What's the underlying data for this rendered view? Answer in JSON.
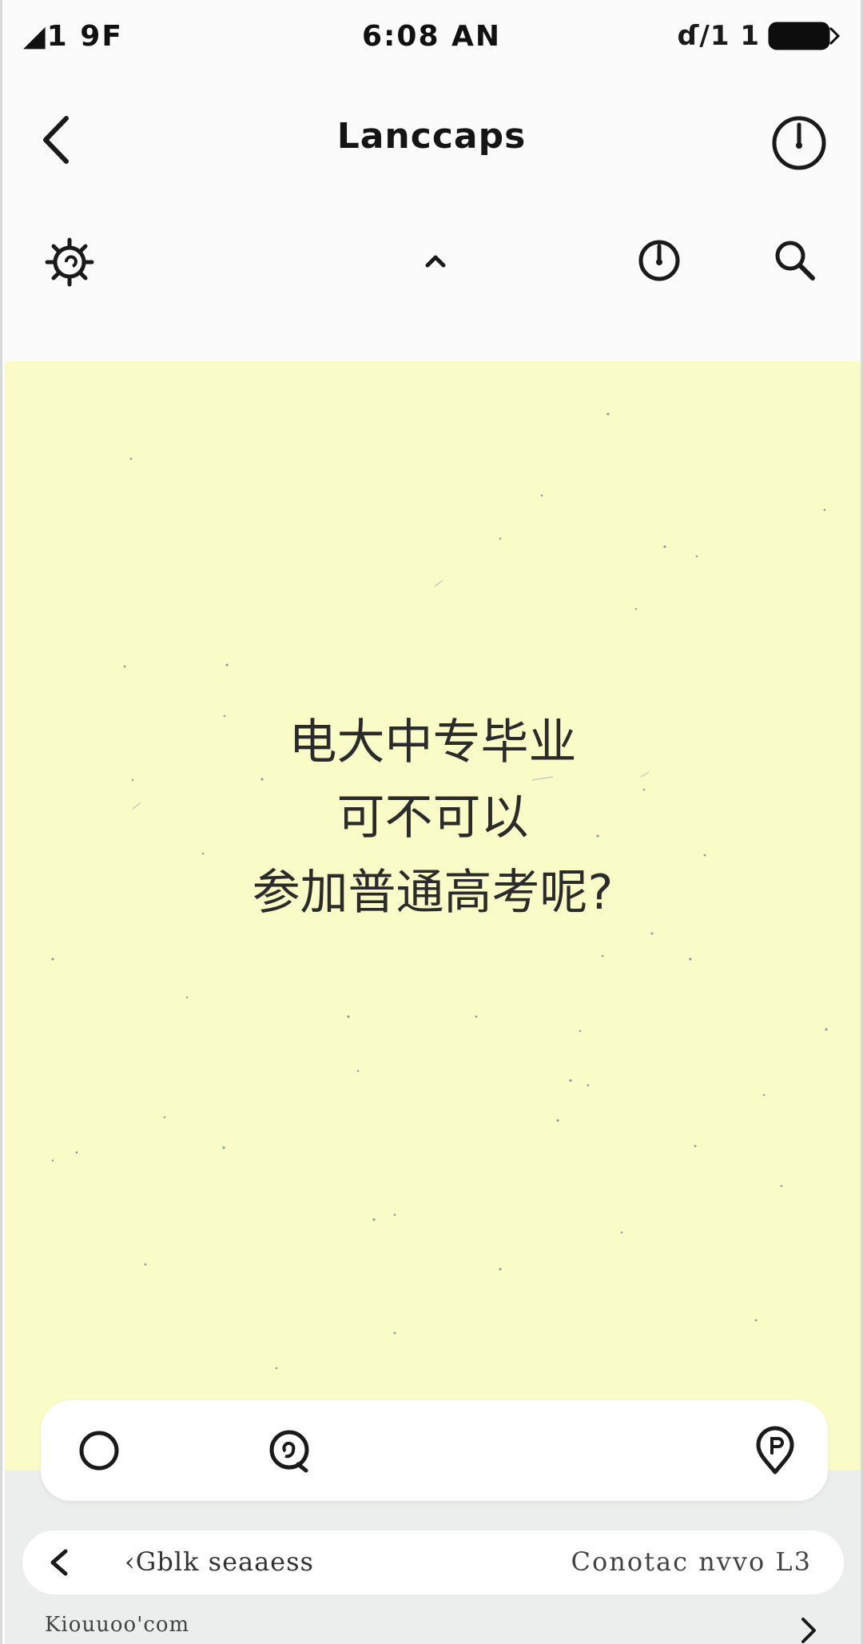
{
  "status_bar": {
    "left": "◢1 9F",
    "time": "6:08 AN",
    "signal": "ɗ/1 1"
  },
  "header": {
    "title": "Lanccaps"
  },
  "content": {
    "background_color": "#fafcc8",
    "question_lines": [
      "电大中专毕业",
      "可不可以",
      "参加普通高考呢?"
    ]
  },
  "bottom_bar": {
    "address_left": "‹Gblk seaaess",
    "address_right": "Conotac nvvo L3",
    "url": "Kiouuoo'com"
  },
  "icons": {
    "back": "chevron-left-icon",
    "history": "clock-icon",
    "settings": "gear-icon",
    "collapse": "chevron-up-icon",
    "search": "search-icon",
    "home": "circle-icon",
    "discover": "spiral-icon",
    "location": "pin-icon",
    "forward": "chevron-right-icon"
  }
}
